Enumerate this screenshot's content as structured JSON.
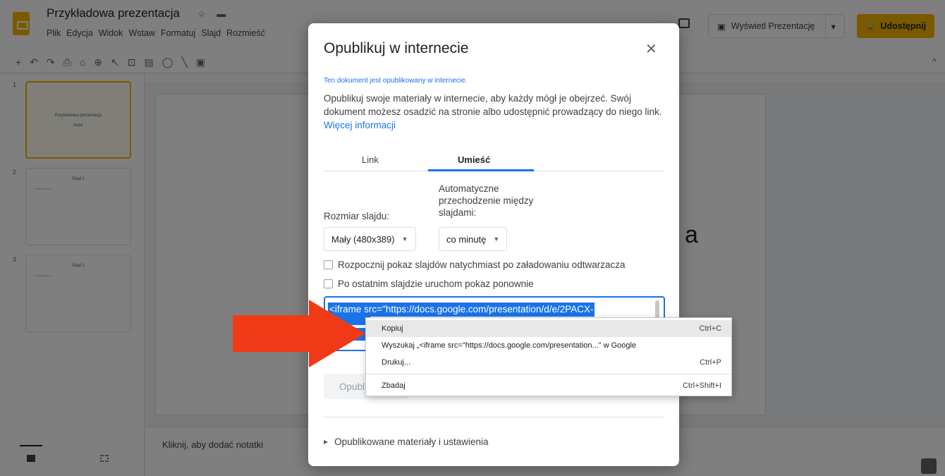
{
  "app": {
    "doc_title": "Przykładowa prezentacja",
    "menu": [
      "Plik",
      "Edycja",
      "Widok",
      "Wstaw",
      "Formatuj",
      "Slajd",
      "Rozmieść"
    ],
    "present_label": "Wyświetl Prezentację",
    "share_label": "Udostępnij",
    "accent_color": "#f4b400"
  },
  "toolbar": {
    "icons": [
      "plus-icon",
      "undo-icon",
      "redo-icon",
      "print-icon",
      "paint-format-icon",
      "zoom-icon",
      "select-icon",
      "textbox-icon",
      "image-icon",
      "shape-icon",
      "line-icon",
      "comment-add-icon"
    ]
  },
  "filmstrip": {
    "slides": [
      {
        "num": "1",
        "title": "Przykładowa prezentacja",
        "body": "Autor"
      },
      {
        "num": "2",
        "title": "Slajd 1",
        "body": "• Treść slajdu 1"
      },
      {
        "num": "3",
        "title": "Slajd 2",
        "body": "• Treść slajdu 2"
      }
    ]
  },
  "notes": {
    "placeholder": "Kliknij, aby dodać notatki"
  },
  "dialog": {
    "title": "Opublikuj w internecie",
    "notice": "Ten dokument jest opublikowany w internecie.",
    "description": "Opublikuj swoje materiały w internecie, aby każdy mógł je obejrzeć. Swój dokument możesz osadzić na stronie albo udostępnić prowadzący do niego link.",
    "more_info": "Więcej informacji",
    "tabs": [
      "Link",
      "Umieść"
    ],
    "active_tab": "Umieść",
    "size_label": "Rozmiar slajdu:",
    "size_value": "Mały (480x389)",
    "auto_label": "Automatyczne przechodzenie między slajdami:",
    "auto_value": "co minutę",
    "checkbox_start": "Rozpocznij pokaz slajdów natychmiast po załadowaniu odtwarzacza",
    "checkbox_restart": "Po ostatnim slajdzie uruchom pokaz ponownie",
    "embed_code": "<iframe src=\"https://docs.google.com/presentation/d/e/2PACX-",
    "publish_label": "Opublikuj",
    "published_settings": "Opublikowane materiały i ustawienia"
  },
  "context_menu": {
    "items": [
      {
        "label": "Kopiuj",
        "shortcut": "Ctrl+C",
        "highlighted": true
      },
      {
        "label": "Wyszukaj „<iframe src=\"https://docs.google.com/presentation...\" w Google",
        "shortcut": ""
      },
      {
        "label": "Drukuj...",
        "shortcut": "Ctrl+P"
      },
      {
        "label": "Zbadaj",
        "shortcut": "Ctrl+Shift+I"
      }
    ]
  },
  "annotation": {
    "arrow_color": "#f03a17"
  }
}
